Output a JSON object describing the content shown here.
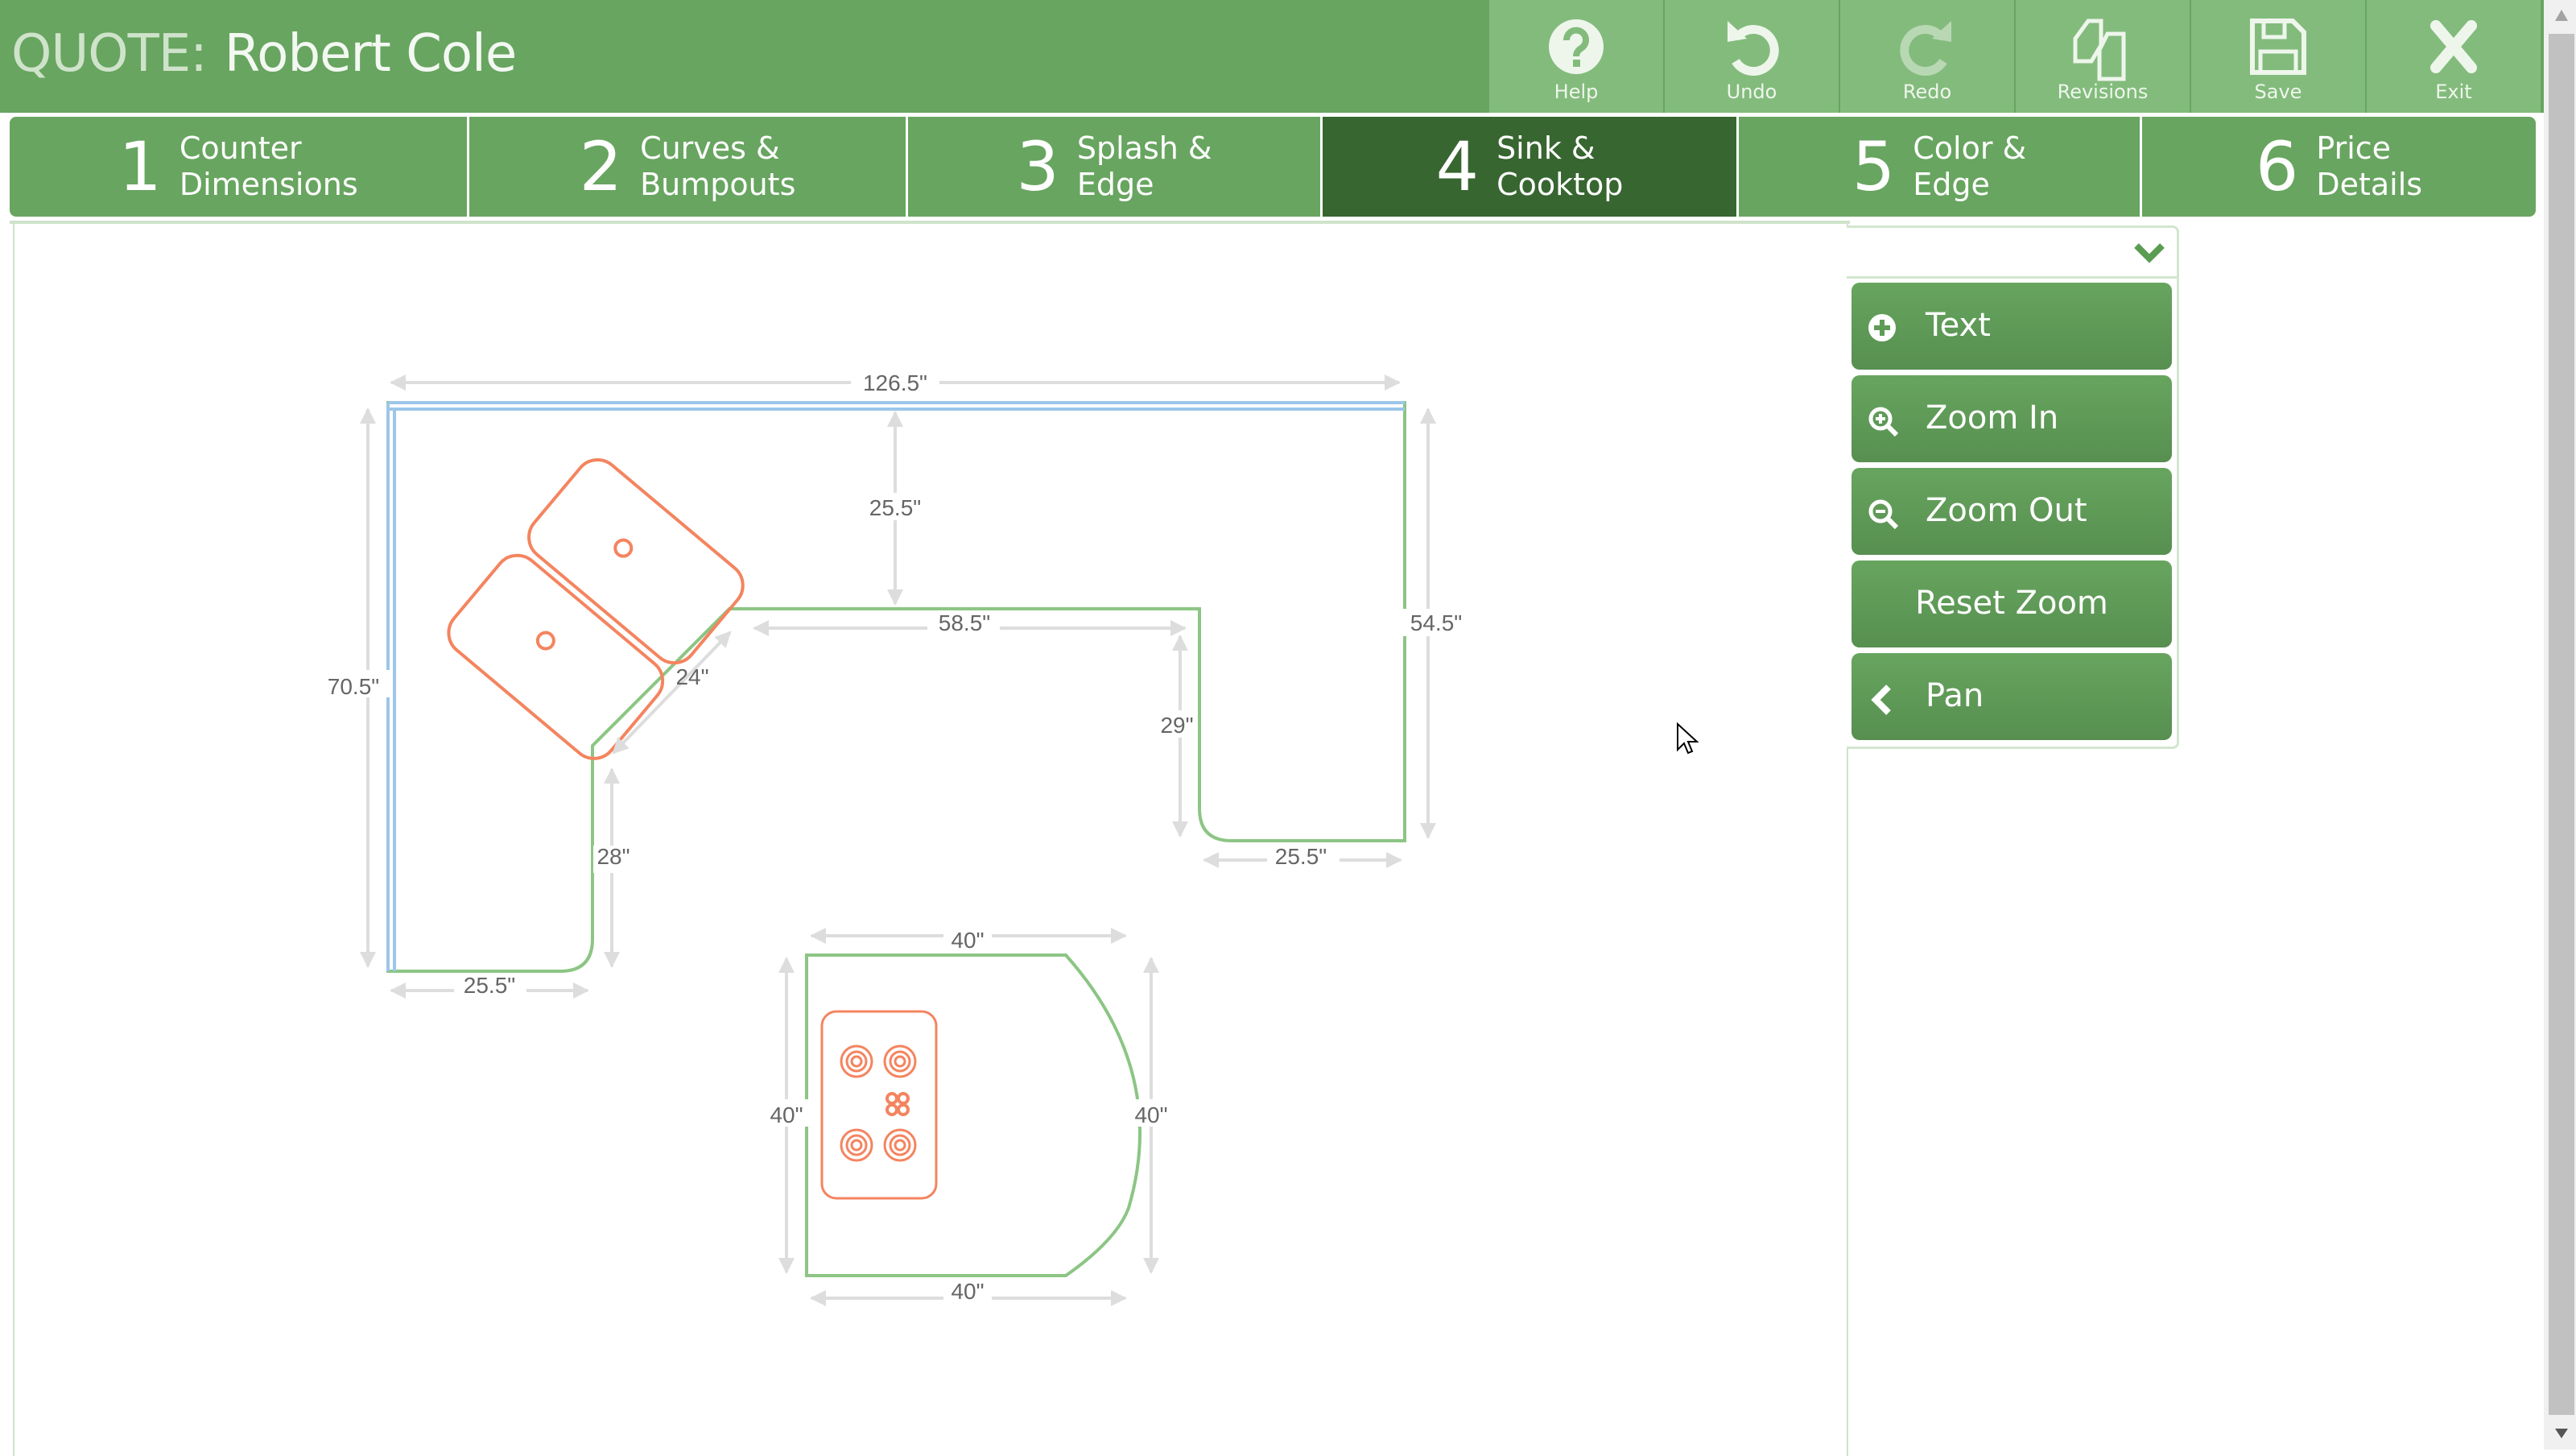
{
  "header": {
    "quote_label": "QUOTE:",
    "customer_name": "Robert Cole"
  },
  "toolbar": [
    {
      "label": "Help",
      "icon": "help-circle-icon"
    },
    {
      "label": "Undo",
      "icon": "undo-icon"
    },
    {
      "label": "Redo",
      "icon": "redo-icon",
      "disabled": true
    },
    {
      "label": "Revisions",
      "icon": "copy-documents-icon"
    },
    {
      "label": "Save",
      "icon": "floppy-disk-icon"
    },
    {
      "label": "Exit",
      "icon": "close-x-icon"
    }
  ],
  "tabs": [
    {
      "num": "1",
      "line1": "Counter",
      "line2": "Dimensions",
      "active": false
    },
    {
      "num": "2",
      "line1": "Curves &",
      "line2": "Bumpouts",
      "active": false
    },
    {
      "num": "3",
      "line1": "Splash &",
      "line2": "Edge",
      "active": false
    },
    {
      "num": "4",
      "line1": "Sink &",
      "line2": "Cooktop",
      "active": true
    },
    {
      "num": "5",
      "line1": "Color &",
      "line2": "Edge",
      "active": false
    },
    {
      "num": "6",
      "line1": "Price",
      "line2": "Details",
      "active": false
    }
  ],
  "side_panel": {
    "collapse_icon": "chevron-down-icon",
    "buttons": [
      {
        "label": "Text",
        "icon": "plus-circle-icon"
      },
      {
        "label": "Zoom In",
        "icon": "zoom-in-icon"
      },
      {
        "label": "Zoom Out",
        "icon": "zoom-out-icon"
      },
      {
        "label": "Reset Zoom",
        "icon": ""
      },
      {
        "label": "Pan",
        "icon": "chevron-left-icon"
      }
    ]
  },
  "drawing": {
    "colors": {
      "counter_edge": "#8cc584",
      "wall_edge": "#9dc6ea",
      "fixture": "#f4845f",
      "dimension": "#dddddd",
      "dimension_text": "#666666"
    },
    "counter_1": {
      "dimensions": {
        "top_width": "126.5\"",
        "left_height": "70.5\"",
        "right_height": "54.5\"",
        "top_depth": "25.5\"",
        "inner_width": "58.5\"",
        "diagonal": "24\"",
        "inner_right_height": "29\"",
        "right_leg_width": "25.5\"",
        "inner_left_height": "28\"",
        "left_leg_width": "25.5\""
      },
      "fixture": "double-sink"
    },
    "counter_2": {
      "dimensions": {
        "top_width": "40\"",
        "bottom_width": "40\"",
        "left_height": "40\"",
        "right_height": "40\""
      },
      "fixture": "cooktop"
    }
  }
}
